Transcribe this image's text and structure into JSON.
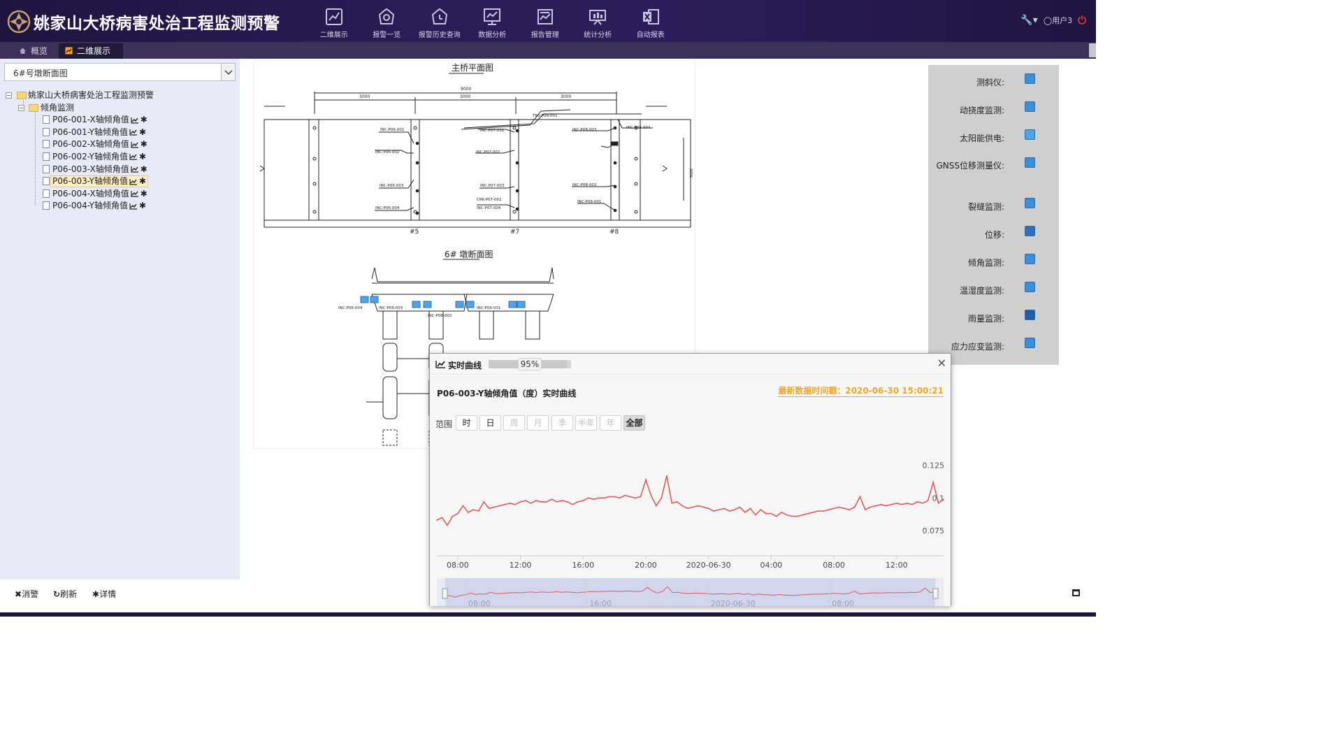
{
  "header": {
    "title": "姚家山大桥病害处治工程监测预警",
    "nav": [
      {
        "label": "二维展示",
        "icon": "line-chart-icon"
      },
      {
        "label": "报警一览",
        "icon": "alarm-bell-icon"
      },
      {
        "label": "报警历史查询",
        "icon": "alarm-history-icon"
      },
      {
        "label": "数据分析",
        "icon": "data-analysis-icon"
      },
      {
        "label": "报告管理",
        "icon": "report-icon"
      },
      {
        "label": "统计分析",
        "icon": "statistics-icon"
      },
      {
        "label": "自动报表",
        "icon": "excel-icon"
      }
    ],
    "user": "用户3"
  },
  "tabs": [
    {
      "label": "概览",
      "icon": "home-icon"
    },
    {
      "label": "二维展示",
      "icon": "chart-tab-icon"
    }
  ],
  "left": {
    "select_value": "6#号墩断面图",
    "tree_root": "姚家山大桥病害处治工程监测预警",
    "tree_group": "倾角监测",
    "tree_items": [
      "P06-001-X轴倾角值",
      "P06-001-Y轴倾角值",
      "P06-002-X轴倾角值",
      "P06-002-Y轴倾角值",
      "P06-003-X轴倾角值",
      "P06-003-Y轴倾角值",
      "P06-004-X轴倾角值",
      "P06-004-Y轴倾角值"
    ],
    "selected_index": 5,
    "footer": {
      "dismiss": "消警",
      "refresh": "刷新",
      "detail": "详情"
    }
  },
  "drawing": {
    "plan_title": "主桥平面图",
    "section_title": "6# 墩断面图",
    "dims": [
      "3000",
      "3000",
      "3000",
      "9000"
    ],
    "pier_labels": [
      "#5",
      "#7",
      "#8"
    ],
    "sensor_labels_plan": [
      "INC-P06-001",
      "INC-P06-002",
      "INC-P06-003",
      "INC-P06-004",
      "INC-P07-001",
      "INC-P07-002",
      "INC-P07-003",
      "INC-P07-004",
      "INC-P08-001",
      "INC-P08-002",
      "INC-P08-003",
      "INC-P08-004",
      "TRS-P08-001",
      "CRK-P07-001"
    ],
    "sensor_labels_section": [
      "INC-P06-004",
      "INC-P06-003",
      "INC-P06-002",
      "INC-P06-001"
    ]
  },
  "legend": [
    {
      "label": "测斜仪:",
      "icon": "inclinometer-icon",
      "color": "#3b8fd9"
    },
    {
      "label": "动挠度监测:",
      "icon": "deflection-icon",
      "color": "#3b8fd9"
    },
    {
      "label": "太阳能供电:",
      "icon": "solar-power-icon",
      "color": "#4ba6e0"
    },
    {
      "label": "GNSS位移测量仪:",
      "icon": "gnss-icon",
      "color": "#3b8fd9"
    },
    {
      "label": "裂缝监测:",
      "icon": "crack-icon",
      "color": "#3b8fd9"
    },
    {
      "label": "位移:",
      "icon": "displacement-icon",
      "color": "#2f6fb8"
    },
    {
      "label": "倾角监测:",
      "icon": "tilt-icon",
      "color": "#3b8fd9"
    },
    {
      "label": "温湿度监测:",
      "icon": "temp-humidity-icon",
      "color": "#3b8fd9"
    },
    {
      "label": "雨量监测:",
      "icon": "rain-icon",
      "color": "#1f5fa8"
    },
    {
      "label": "应力应变监测:",
      "icon": "stress-icon",
      "color": "#3b8fd9"
    }
  ],
  "popup": {
    "title": "实时曲线",
    "progress_percent": 95,
    "progress_text": "95%",
    "curve_title": "P06-003-Y轴倾角值（度）实时曲线",
    "latest_time": "最新数据时间戳：2020-06-30 15:00:21",
    "range_label": "范围",
    "range_buttons": [
      {
        "label": "时",
        "state": "normal"
      },
      {
        "label": "日",
        "state": "normal"
      },
      {
        "label": "周",
        "state": "disabled"
      },
      {
        "label": "月",
        "state": "disabled"
      },
      {
        "label": "季",
        "state": "disabled"
      },
      {
        "label": "半年",
        "state": "disabled"
      },
      {
        "label": "年",
        "state": "disabled"
      },
      {
        "label": "全部",
        "state": "active"
      }
    ]
  },
  "chart_data": {
    "type": "line",
    "series": [
      {
        "color": "#e05a5a",
        "x": [
          "06:40",
          "07:00",
          "07:20",
          "07:40",
          "08:00",
          "08:20",
          "08:40",
          "09:00",
          "09:20",
          "09:40",
          "10:00",
          "10:20",
          "10:40",
          "11:00",
          "11:20",
          "11:40",
          "12:00",
          "12:20",
          "12:40",
          "13:00",
          "13:20",
          "13:40",
          "14:00",
          "14:20",
          "14:40",
          "15:00",
          "15:20",
          "15:40",
          "16:00",
          "16:20",
          "16:40",
          "17:00",
          "17:20",
          "17:40",
          "18:00",
          "18:20",
          "18:40",
          "19:00",
          "19:20",
          "19:40",
          "20:00",
          "20:20",
          "20:40",
          "21:00",
          "21:20",
          "21:40",
          "22:00",
          "22:20",
          "22:40",
          "23:00",
          "23:20",
          "23:40",
          "00:00",
          "00:20",
          "00:40",
          "01:00",
          "01:20",
          "01:40",
          "02:00",
          "02:20",
          "02:40",
          "03:00",
          "03:20",
          "03:40",
          "04:00",
          "04:20",
          "04:40",
          "05:00",
          "05:20",
          "05:40",
          "06:00",
          "06:20",
          "06:40",
          "07:00",
          "07:20",
          "07:40",
          "08:00",
          "08:20",
          "08:40",
          "09:00",
          "09:20",
          "09:40",
          "10:00",
          "10:20",
          "10:40",
          "11:00",
          "11:20",
          "11:40",
          "12:00",
          "12:20",
          "12:40",
          "13:00",
          "13:20",
          "13:40",
          "14:00",
          "14:20",
          "14:40",
          "15:00"
        ],
        "y": [
          0.083,
          0.085,
          0.079,
          0.086,
          0.088,
          0.094,
          0.089,
          0.091,
          0.09,
          0.097,
          0.092,
          0.093,
          0.094,
          0.095,
          0.096,
          0.095,
          0.097,
          0.098,
          0.096,
          0.098,
          0.097,
          0.097,
          0.099,
          0.097,
          0.098,
          0.097,
          0.095,
          0.097,
          0.098,
          0.1,
          0.099,
          0.1,
          0.1,
          0.101,
          0.101,
          0.1,
          0.102,
          0.101,
          0.1,
          0.101,
          0.114,
          0.102,
          0.094,
          0.1,
          0.117,
          0.096,
          0.097,
          0.094,
          0.092,
          0.093,
          0.094,
          0.093,
          0.092,
          0.09,
          0.091,
          0.092,
          0.09,
          0.091,
          0.093,
          0.089,
          0.092,
          0.087,
          0.091,
          0.088,
          0.088,
          0.086,
          0.089,
          0.087,
          0.086,
          0.086,
          0.087,
          0.088,
          0.089,
          0.09,
          0.09,
          0.091,
          0.092,
          0.093,
          0.092,
          0.091,
          0.093,
          0.101,
          0.091,
          0.093,
          0.094,
          0.095,
          0.094,
          0.095,
          0.096,
          0.095,
          0.096,
          0.095,
          0.097,
          0.096,
          0.098,
          0.112,
          0.096,
          0.099
        ]
      }
    ],
    "ytick_labels": [
      "0.125",
      "0.1",
      "0.075"
    ],
    "ylim": [
      0.06,
      0.135
    ],
    "xtick_labels": [
      "08:00",
      "12:00",
      "16:00",
      "20:00",
      "2020-06-30",
      "04:00",
      "08:00",
      "12:00"
    ],
    "xtick_index": [
      4,
      16,
      28,
      40,
      52,
      64,
      76,
      88
    ],
    "navigator_labels": [
      "08:00",
      "16:00",
      "2020-06-30",
      "08:00"
    ],
    "navigator_index": [
      4,
      28,
      52,
      76
    ],
    "grid": false,
    "legend": "none"
  }
}
